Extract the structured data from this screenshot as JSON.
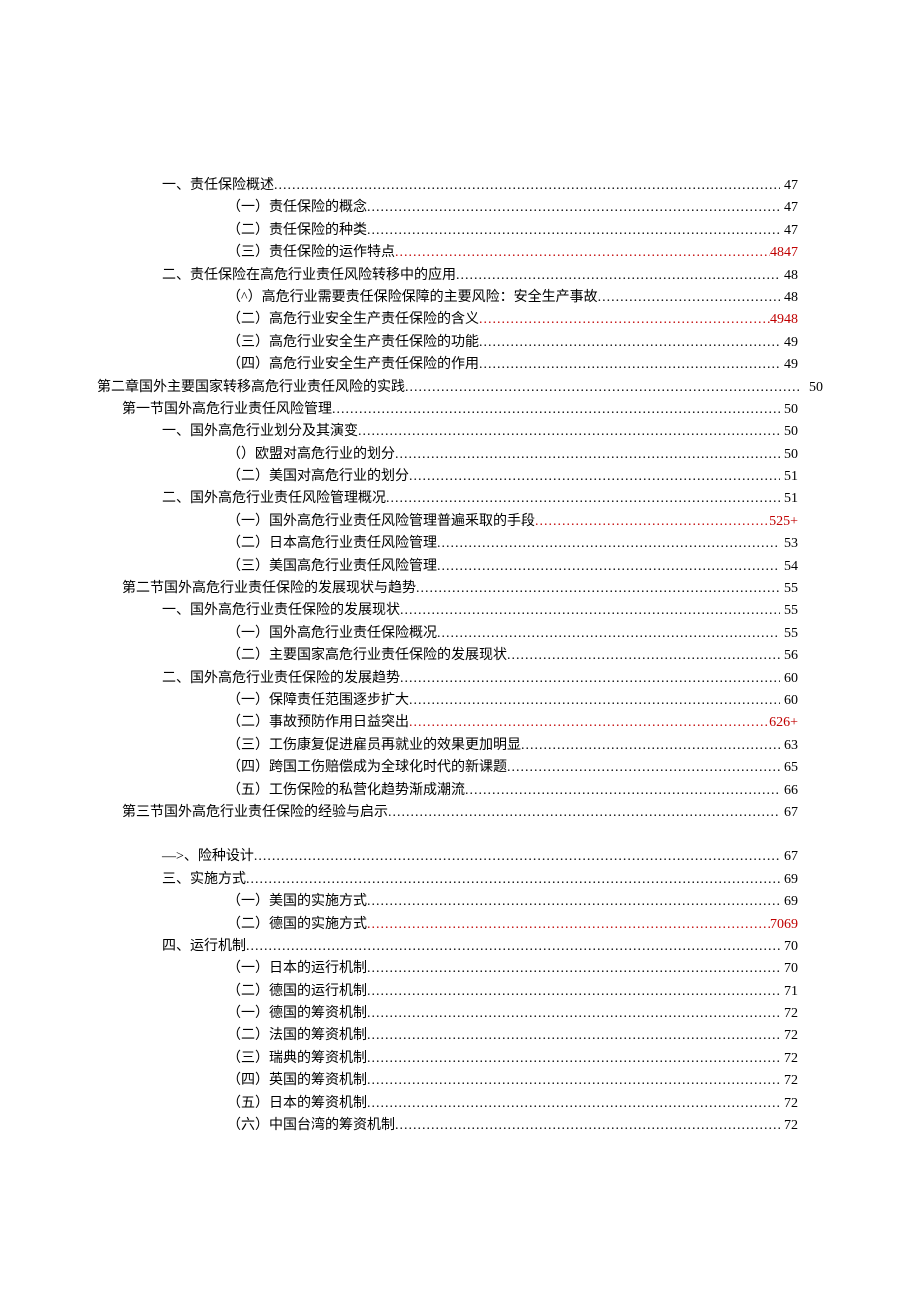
{
  "toc": [
    {
      "indent": "in1",
      "label": "一、责任保险概述",
      "page": "47",
      "red": false
    },
    {
      "indent": "in3",
      "label": "（一）责任保险的概念",
      "page": "47",
      "red": false
    },
    {
      "indent": "in3",
      "label": "（二）责任保险的种类",
      "page": "47",
      "red": false
    },
    {
      "indent": "in3",
      "label": "（三）责任保险的运作特点",
      "page": "4847",
      "red": true
    },
    {
      "indent": "in1",
      "label": "二、责任保险在高危行业责任风险转移中的应用",
      "page": "48",
      "red": false
    },
    {
      "indent": "in3",
      "label": "（^）高危行业需要责任保险保障的主要风险：安全生产事故",
      "page": "48",
      "red": false
    },
    {
      "indent": "in3",
      "label": "（二）高危行业安全生产责任保险的含义",
      "page": "4948",
      "red": true
    },
    {
      "indent": "in3",
      "label": "（三）高危行业安全生产责任保险的功能",
      "page": "49",
      "red": false
    },
    {
      "indent": "in3",
      "label": "（四）高危行业安全生产责任保险的作用",
      "page": "49",
      "red": false
    },
    {
      "indent": "in4",
      "label": "第二章国外主要国家转移高危行业责任风险的实践",
      "page": "50",
      "red": false,
      "chapter": true
    },
    {
      "indent": "in0",
      "label": "第一节国外高危行业责任风险管理",
      "page": "50",
      "red": false
    },
    {
      "indent": "in2",
      "label": "一、国外高危行业划分及其演变",
      "page": "50",
      "red": false
    },
    {
      "indent": "in3",
      "label": "（）欧盟对高危行业的划分",
      "page": "50",
      "red": false
    },
    {
      "indent": "in3",
      "label": "（二）美国对高危行业的划分",
      "page": "51",
      "red": false
    },
    {
      "indent": "in2",
      "label": "二、国外高危行业责任风险管理概况",
      "page": "51",
      "red": false
    },
    {
      "indent": "in3",
      "label": "（一）国外高危行业责任风险管理普遍釆取的手段",
      "page": "525+",
      "red": true
    },
    {
      "indent": "in3",
      "label": "（二）日本高危行业责任风险管理",
      "page": "53",
      "red": false
    },
    {
      "indent": "in3",
      "label": "（三）美国高危行业责任风险管理",
      "page": "54",
      "red": false
    },
    {
      "indent": "in0",
      "label": "第二节国外高危行业责任保险的发展现状与趋势",
      "page": "55",
      "red": false
    },
    {
      "indent": "in2",
      "label": "一、国外高危行业责任保险的发展现状",
      "page": "55",
      "red": false
    },
    {
      "indent": "in3",
      "label": "（一）国外高危行业责任保险概况",
      "page": "55",
      "red": false
    },
    {
      "indent": "in3",
      "label": "（二）主要国家高危行业责任保险的发展现状",
      "page": "56",
      "red": false
    },
    {
      "indent": "in2",
      "label": "二、国外高危行业责任保险的发展趋势",
      "page": "60",
      "red": false
    },
    {
      "indent": "in3",
      "label": "（一）保障责任范围逐步扩大",
      "page": "60",
      "red": false
    },
    {
      "indent": "in3",
      "label": "（二）事故预防作用日益突出",
      "page": "626+",
      "red": true
    },
    {
      "indent": "in3",
      "label": "（三）工伤康复促进雇员再就业的效果更加明显",
      "page": "63",
      "red": false
    },
    {
      "indent": "in3",
      "label": "（四）跨国工伤赔偿成为全球化时代的新课题",
      "page": "65",
      "red": false
    },
    {
      "indent": "in3",
      "label": "（五）工伤保险的私营化趋势渐成潮流",
      "page": "66",
      "red": false
    },
    {
      "indent": "in0",
      "label": "第三节国外高危行业责任保险的经验与启示",
      "page": "67",
      "red": false
    },
    {
      "indent": "in2",
      "label": "—>、险种设计",
      "page": "67",
      "red": false,
      "gapBefore": true
    },
    {
      "indent": "in2",
      "label": "三、实施方式",
      "page": "69",
      "red": false
    },
    {
      "indent": "in3",
      "label": "（一）美国的实施方式",
      "page": "69",
      "red": false
    },
    {
      "indent": "in3",
      "label": "（二）德国的实施方式",
      "page": "7069",
      "red": true
    },
    {
      "indent": "in2",
      "label": "四、运行机制",
      "page": "70",
      "red": false
    },
    {
      "indent": "in3",
      "label": "（一）日本的运行机制",
      "page": "70",
      "red": false
    },
    {
      "indent": "in3",
      "label": "（二）德国的运行机制",
      "page": "71",
      "red": false
    },
    {
      "indent": "in3",
      "label": "（一）德国的筹资机制",
      "page": "72",
      "red": false
    },
    {
      "indent": "in3",
      "label": "（二）法国的筹资机制",
      "page": "72",
      "red": false
    },
    {
      "indent": "in3",
      "label": "（三）瑞典的筹资机制",
      "page": "72",
      "red": false
    },
    {
      "indent": "in3",
      "label": "（四）英国的筹资机制",
      "page": "72",
      "red": false
    },
    {
      "indent": "in3",
      "label": "（五）日本的筹资机制",
      "page": "72",
      "red": false
    },
    {
      "indent": "in3",
      "label": "（六）中国台湾的筹资机制",
      "page": "72",
      "red": false
    }
  ]
}
